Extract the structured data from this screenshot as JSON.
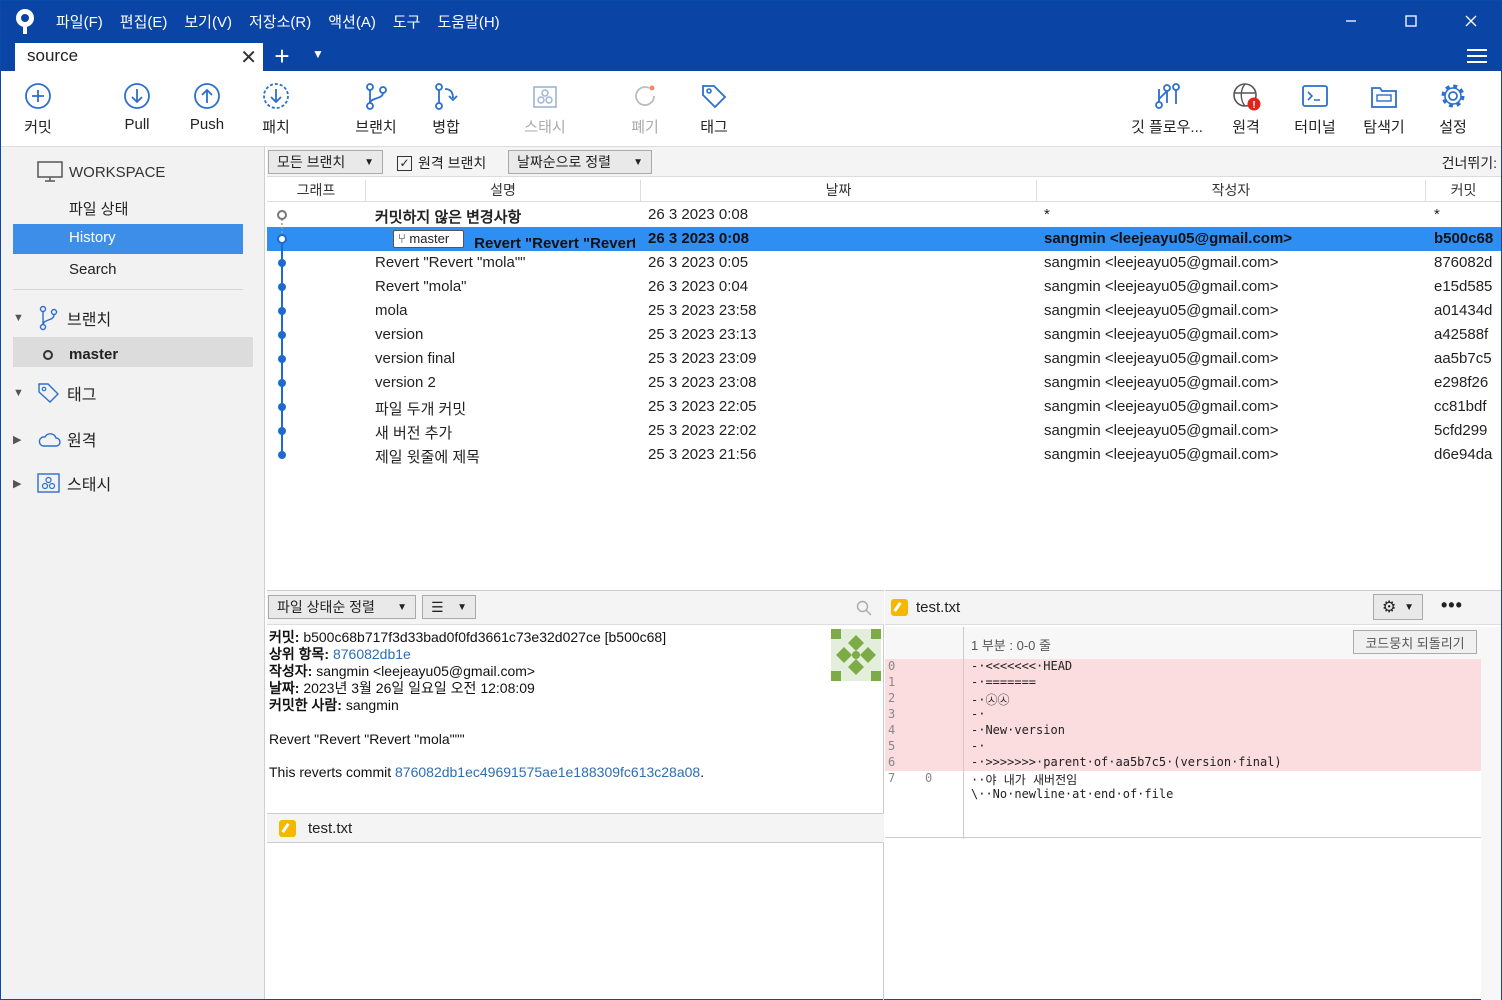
{
  "menu": [
    "파일(F)",
    "편집(E)",
    "보기(V)",
    "저장소(R)",
    "액션(A)",
    "도구",
    "도움말(H)"
  ],
  "tab": {
    "title": "source"
  },
  "toolbar": {
    "commit": "커밋",
    "pull": "Pull",
    "push": "Push",
    "patch": "패치",
    "branch": "브랜치",
    "merge": "병합",
    "stash": "스태시",
    "discard": "폐기",
    "tag": "태그",
    "gitflow": "깃 플로우...",
    "remote": "원격",
    "terminal": "터미널",
    "explorer": "탐색기",
    "settings": "설정"
  },
  "sidebar": {
    "workspace": "WORKSPACE",
    "items": [
      "파일 상태",
      "History",
      "Search"
    ],
    "branches": "브랜치",
    "current_branch": "master",
    "tags": "태그",
    "remotes": "원격",
    "stashes": "스태시"
  },
  "filter": {
    "branches": "모든 브랜치",
    "remote_branches": "원격 브랜치",
    "sort": "날짜순으로 정렬",
    "jump": "건너뛰기:"
  },
  "columns": {
    "graph": "그래프",
    "desc": "설명",
    "date": "날짜",
    "author": "작성자",
    "commit": "커밋"
  },
  "commits": [
    {
      "desc": "커밋하지 않은 변경사항",
      "date": "26 3 2023 0:08",
      "author": "*",
      "hash": "*"
    },
    {
      "branch": "master",
      "desc": "Revert \"Revert \"Revert \"mola\"\"\"",
      "date": "26 3 2023 0:08",
      "author": "sangmin <leejeayu05@gmail.com>",
      "hash": "b500c68"
    },
    {
      "desc": "Revert \"Revert \"mola\"\"",
      "date": "26 3 2023 0:05",
      "author": "sangmin <leejeayu05@gmail.com>",
      "hash": "876082d"
    },
    {
      "desc": "Revert \"mola\"",
      "date": "26 3 2023 0:04",
      "author": "sangmin <leejeayu05@gmail.com>",
      "hash": "e15d585"
    },
    {
      "desc": "mola",
      "date": "25 3 2023 23:58",
      "author": "sangmin <leejeayu05@gmail.com>",
      "hash": "a01434d"
    },
    {
      "desc": "version",
      "date": "25 3 2023 23:13",
      "author": "sangmin <leejeayu05@gmail.com>",
      "hash": "a42588f"
    },
    {
      "desc": "version final",
      "date": "25 3 2023 23:09",
      "author": "sangmin <leejeayu05@gmail.com>",
      "hash": "aa5b7c5"
    },
    {
      "desc": "version 2",
      "date": "25 3 2023 23:08",
      "author": "sangmin <leejeayu05@gmail.com>",
      "hash": "e298f26"
    },
    {
      "desc": "파일 두개 커밋",
      "date": "25 3 2023 22:05",
      "author": "sangmin <leejeayu05@gmail.com>",
      "hash": "cc81bdf"
    },
    {
      "desc": "새 버전 추가",
      "date": "25 3 2023 22:02",
      "author": "sangmin <leejeayu05@gmail.com>",
      "hash": "5cfd299"
    },
    {
      "desc": "제일 윗줄에 제목",
      "date": "25 3 2023 21:56",
      "author": "sangmin <leejeayu05@gmail.com>",
      "hash": "d6e94da"
    }
  ],
  "details": {
    "sort": "파일 상태순 정렬",
    "commit_label": "커밋:",
    "commit": "b500c68b717f3d33bad0f0fd3661c73e32d027ce [b500c68]",
    "parent_label": "상위 항목:",
    "parent": "876082db1e",
    "author_label": "작성자:",
    "author": "sangmin <leejeayu05@gmail.com>",
    "date_label": "날짜:",
    "date": "2023년 3월 26일 일요일 오전 12:08:09",
    "committer_label": "커밋한 사람:",
    "committer": "sangmin",
    "message": "Revert \"Revert \"Revert \"mola\"\"\"",
    "reverts_prefix": "This reverts commit ",
    "reverts_hash": "876082db1ec49691575ae1e188309fc613c28a08",
    "reverts_suffix": ".",
    "file": "test.txt"
  },
  "diff": {
    "file": "test.txt",
    "hunk": "1 부분 : 0-0 줄",
    "revert_button": "코드뭉치 되돌리기",
    "lines": [
      {
        "n1": "0",
        "n2": "",
        "t": "-·<<<<<<<·HEAD",
        "type": "rm"
      },
      {
        "n1": "1",
        "n2": "",
        "t": "-·=======",
        "type": "rm"
      },
      {
        "n1": "2",
        "n2": "",
        "t": "-·㉦㉦",
        "type": "rm"
      },
      {
        "n1": "3",
        "n2": "",
        "t": "-·",
        "type": "rm"
      },
      {
        "n1": "4",
        "n2": "",
        "t": "-·New·version",
        "type": "rm"
      },
      {
        "n1": "5",
        "n2": "",
        "t": "-·",
        "type": "rm"
      },
      {
        "n1": "6",
        "n2": "",
        "t": "-·>>>>>>>·parent·of·aa5b7c5·(version·final)",
        "type": "rm"
      },
      {
        "n1": "7",
        "n2": "0",
        "t": "··야 내가 새버전임",
        "type": "ctx"
      },
      {
        "n1": "",
        "n2": "",
        "t": "\\··No·newline·at·end·of·file",
        "type": "ctx"
      }
    ]
  },
  "colors": {
    "titlebar": "#0a45a6",
    "accent": "#3d8ee8",
    "selected_row": "#2e8ef2",
    "removed": "#fbdcdf",
    "link": "#2d6db4"
  }
}
